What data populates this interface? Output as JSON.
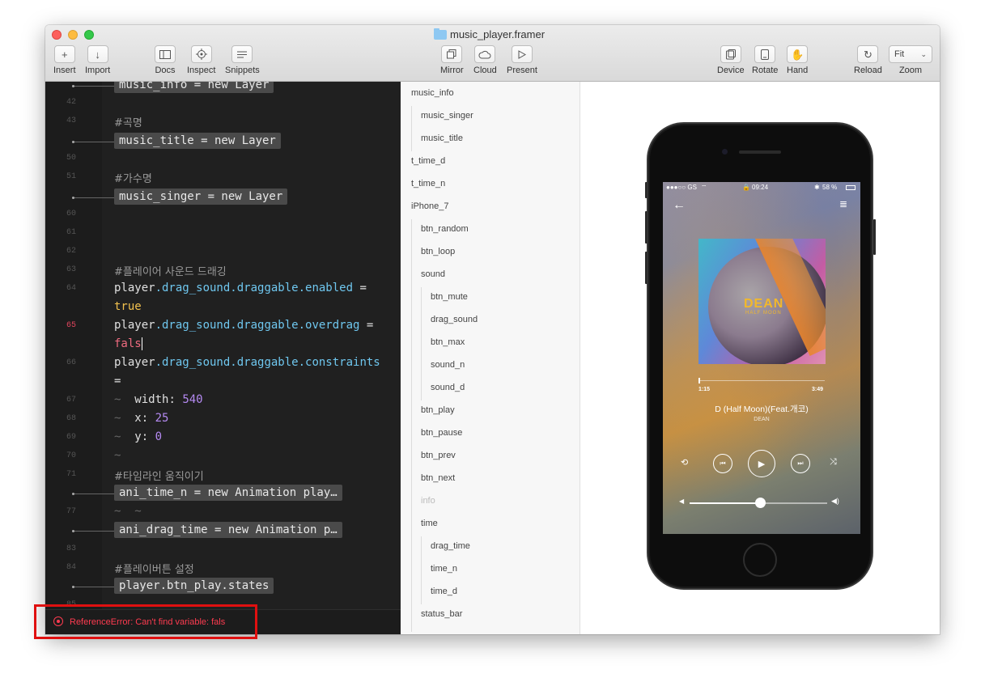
{
  "window": {
    "title": "music_player.framer"
  },
  "toolbar": {
    "insert": "Insert",
    "import": "Import",
    "docs": "Docs",
    "inspect": "Inspect",
    "snippets": "Snippets",
    "mirror": "Mirror",
    "cloud": "Cloud",
    "present": "Present",
    "device": "Device",
    "rotate": "Rotate",
    "hand": "Hand",
    "reload": "Reload",
    "zoom_label": "Zoom",
    "zoom_value": "Fit"
  },
  "editor": {
    "line_numbers": [
      "42",
      "43",
      "50",
      "51",
      "60",
      "61",
      "62",
      "63",
      "64",
      "65",
      "66",
      "67",
      "68",
      "69",
      "70",
      "71",
      "77",
      "83",
      "84",
      "85"
    ],
    "error_line": "65",
    "lines": {
      "music_info": "music_info = new Layer",
      "comment_title": "#곡명",
      "music_title": "music_title = new Layer",
      "comment_singer": "#가수명",
      "music_singer": "music_singer = new Layer",
      "comment_drag": "#플레이어 사운드 드래깅",
      "player": "player",
      "drag_enabled": ".drag_sound.draggable.enabled",
      "equals": " =",
      "kw_true": "true",
      "drag_overdrag": ".drag_sound.draggable.overdrag",
      "fals": "fals",
      "drag_constraints": ".drag_sound.draggable.constraints",
      "eq_only": "=",
      "width_key": "width: ",
      "width_val": "540",
      "x_key": "x: ",
      "x_val": "25",
      "y_key": "y: ",
      "y_val": "0",
      "comment_timeline": "#타임라인 움직이기",
      "ani_time_n": "ani_time_n = new Animation play…",
      "ani_drag_time": "ani_drag_time = new Animation p…",
      "comment_buttons": "#플레이버튼 설정",
      "btn_play_states": "player.btn_play.states"
    },
    "error": "ReferenceError: Can't find variable: fals"
  },
  "layers": [
    {
      "name": "music_info",
      "level": 0
    },
    {
      "name": "music_singer",
      "level": 1
    },
    {
      "name": "music_title",
      "level": 1
    },
    {
      "name": "t_time_d",
      "level": 0
    },
    {
      "name": "t_time_n",
      "level": 0
    },
    {
      "name": "iPhone_7",
      "level": 0
    },
    {
      "name": "btn_random",
      "level": 1
    },
    {
      "name": "btn_loop",
      "level": 1
    },
    {
      "name": "sound",
      "level": 1
    },
    {
      "name": "btn_mute",
      "level": 2
    },
    {
      "name": "drag_sound",
      "level": 2
    },
    {
      "name": "btn_max",
      "level": 2
    },
    {
      "name": "sound_n",
      "level": 2
    },
    {
      "name": "sound_d",
      "level": 2
    },
    {
      "name": "btn_play",
      "level": 1
    },
    {
      "name": "btn_pause",
      "level": 1
    },
    {
      "name": "btn_prev",
      "level": 1
    },
    {
      "name": "btn_next",
      "level": 1
    },
    {
      "name": "info",
      "level": 1,
      "dim": true
    },
    {
      "name": "time",
      "level": 1
    },
    {
      "name": "drag_time",
      "level": 2
    },
    {
      "name": "time_n",
      "level": 2
    },
    {
      "name": "time_d",
      "level": 2
    },
    {
      "name": "status_bar",
      "level": 1
    }
  ],
  "phone": {
    "status": {
      "carrier": "●●●○○ GS",
      "time": "09:24",
      "battery": "58 %"
    },
    "album": {
      "logo": "DEAN",
      "subtitle": "HALF MOON"
    },
    "time_elapsed": "1:15",
    "time_total": "3:49",
    "song_title": "D (Half Moon)(Feat.개코)",
    "artist": "DEAN",
    "progress": 0.0,
    "volume": 0.52
  },
  "colors": {
    "error": "#ff3b50",
    "highlight_box": "#e01010",
    "code_property": "#6fc7ef",
    "code_keyword": "#f2c14e",
    "code_number": "#b58af2"
  }
}
